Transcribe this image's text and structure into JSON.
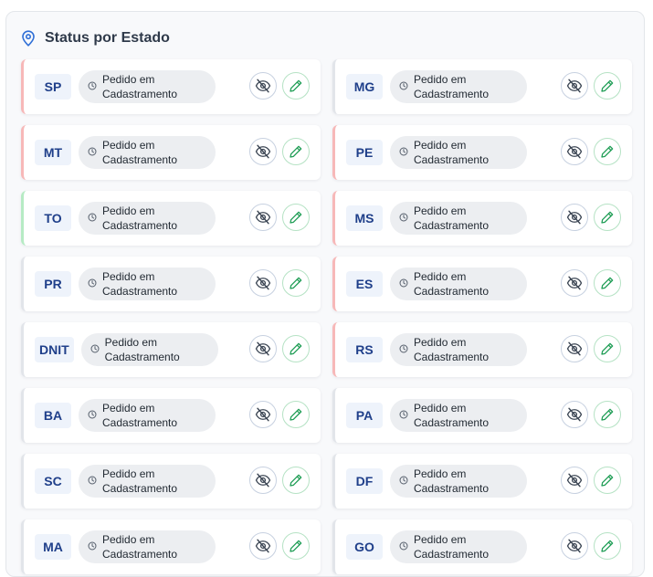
{
  "panel": {
    "title": "Status por Estado",
    "icon": "map-pin-icon"
  },
  "colors": {
    "accent": "#2f6fd6",
    "code_text": "#1f3f8a",
    "edit_green": "#1f9d55",
    "red_border": "#f7b8b8",
    "green_border": "#b6ebc4"
  },
  "states": [
    {
      "code": "SP",
      "status": "Pedido em Cadastramento",
      "accent": "red"
    },
    {
      "code": "MG",
      "status": "Pedido em Cadastramento",
      "accent": "gray"
    },
    {
      "code": "MT",
      "status": "Pedido em Cadastramento",
      "accent": "red"
    },
    {
      "code": "PE",
      "status": "Pedido em Cadastramento",
      "accent": "red"
    },
    {
      "code": "TO",
      "status": "Pedido em Cadastramento",
      "accent": "green"
    },
    {
      "code": "MS",
      "status": "Pedido em Cadastramento",
      "accent": "red"
    },
    {
      "code": "PR",
      "status": "Pedido em Cadastramento",
      "accent": "gray"
    },
    {
      "code": "ES",
      "status": "Pedido em Cadastramento",
      "accent": "red"
    },
    {
      "code": "DNIT",
      "status": "Pedido em Cadastramento",
      "accent": "gray"
    },
    {
      "code": "RS",
      "status": "Pedido em Cadastramento",
      "accent": "red"
    },
    {
      "code": "BA",
      "status": "Pedido em Cadastramento",
      "accent": "gray"
    },
    {
      "code": "PA",
      "status": "Pedido em Cadastramento",
      "accent": "gray"
    },
    {
      "code": "SC",
      "status": "Pedido em Cadastramento",
      "accent": "gray"
    },
    {
      "code": "DF",
      "status": "Pedido em Cadastramento",
      "accent": "gray"
    },
    {
      "code": "MA",
      "status": "Pedido em Cadastramento",
      "accent": "gray"
    },
    {
      "code": "GO",
      "status": "Pedido em Cadastramento",
      "accent": "gray"
    }
  ]
}
